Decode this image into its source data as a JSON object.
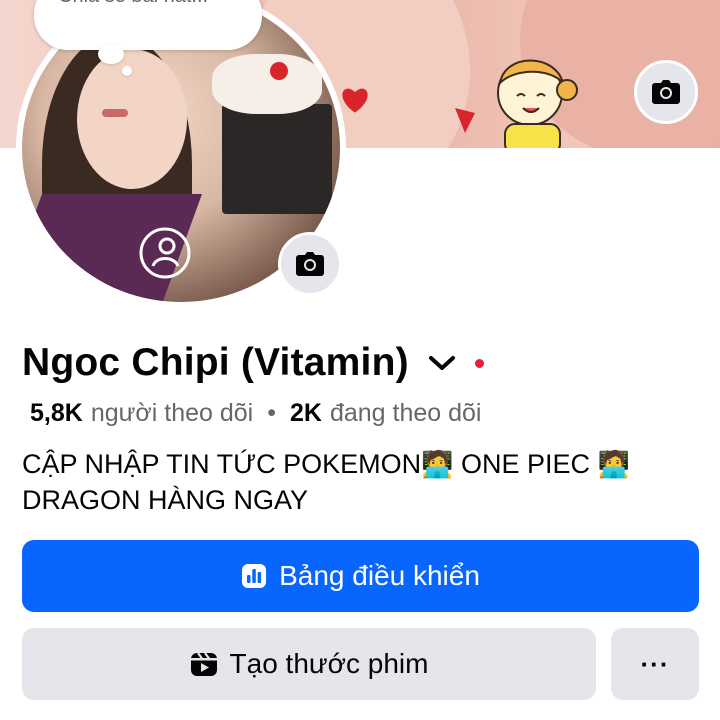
{
  "cover": {
    "camera_icon": "camera-icon"
  },
  "note": {
    "text": "Chia sẻ bài hát..."
  },
  "profile": {
    "name": "Ngoc Chipi (Vitamin)",
    "followers_count": "5,8K",
    "followers_label": "người theo dõi",
    "separator": "•",
    "following_count": "2K",
    "following_label": "đang theo dõi",
    "bio_line1": "CẬP NHẬP TIN TỨC POKEMON",
    "bio_emoji1": "🧑‍💻",
    "bio_mid": " ONE PIEC ",
    "bio_emoji2": "🧑‍💻",
    "bio_line2": "DRAGON HÀNG NGAY"
  },
  "buttons": {
    "dashboard_label": "Bảng điều khiển",
    "reel_label": "Tạo thước phim",
    "more_label": "···"
  },
  "colors": {
    "primary": "#0866ff",
    "secondary_bg": "#e4e6eb",
    "muted_text": "#65676b",
    "status_dot": "#e41e3f"
  }
}
